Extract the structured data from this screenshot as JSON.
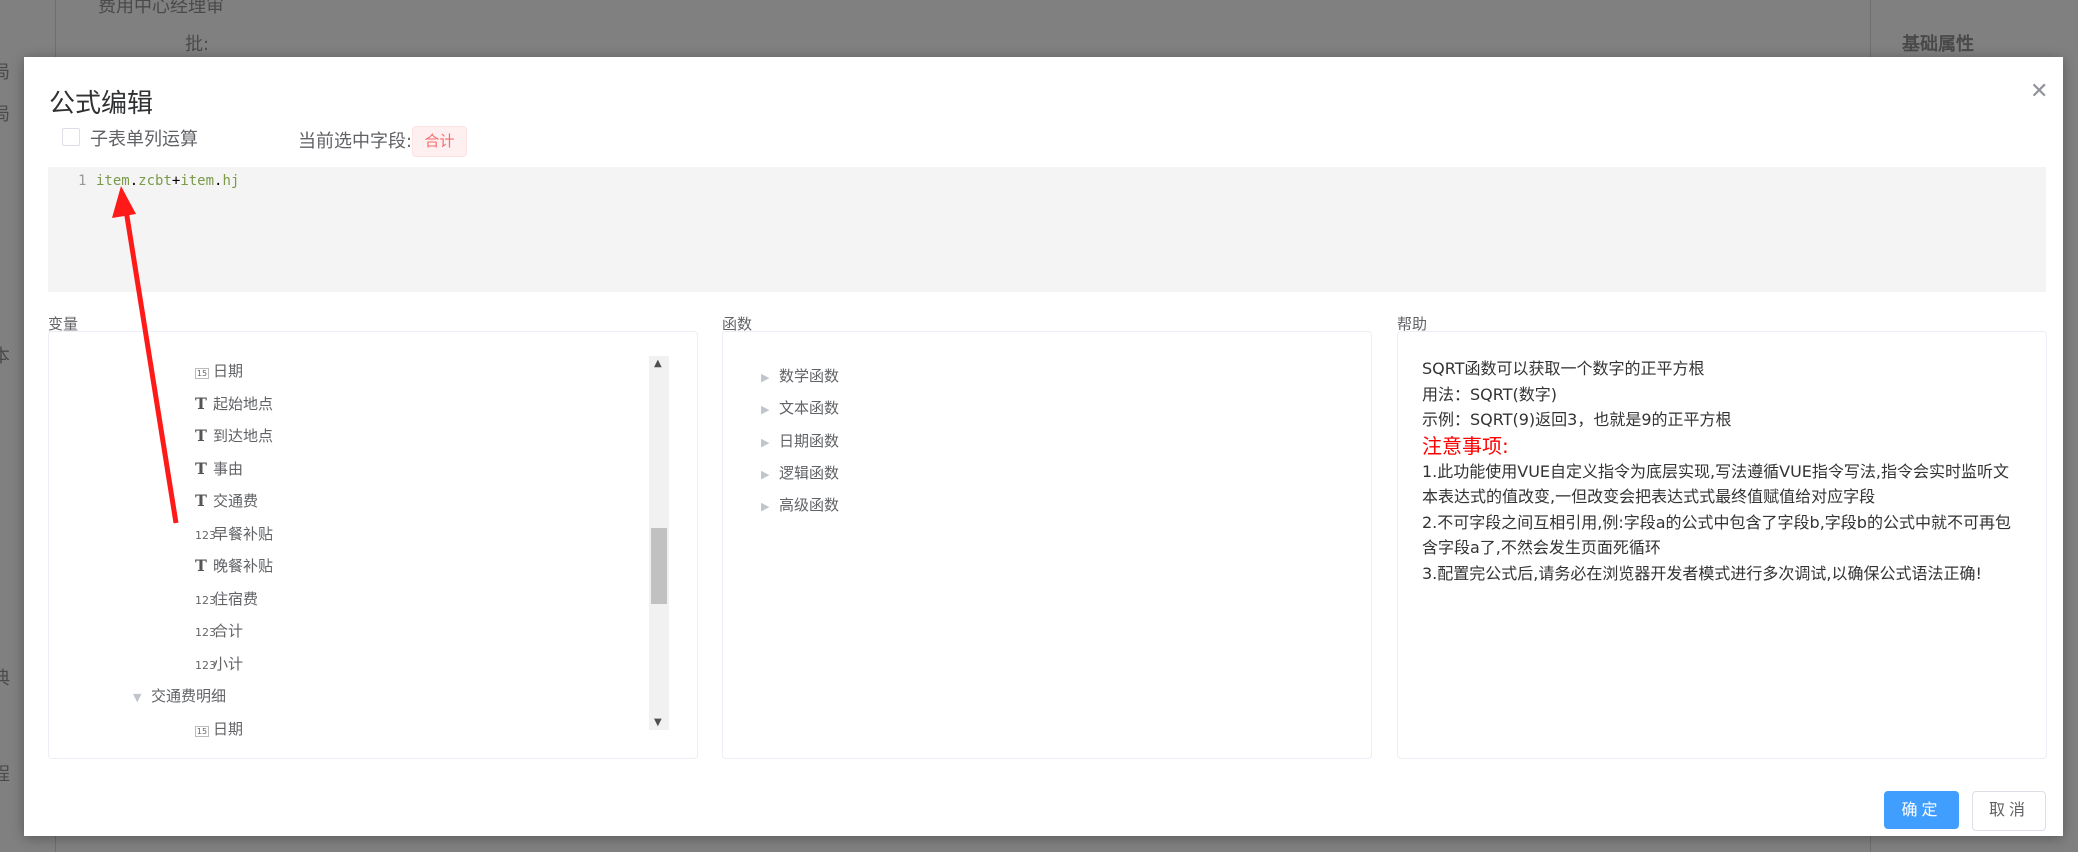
{
  "background": {
    "top_text": "费用中心经理审",
    "approve_label": "批:",
    "right_panel_title": "基础属性",
    "left_fragments": [
      "局",
      "局",
      "本",
      "典",
      "程"
    ]
  },
  "dialog": {
    "title": "公式编辑",
    "close_icon": "close-icon",
    "subform_checkbox_label": "子表单列运算",
    "subform_checked": false,
    "current_field_label": "当前选中字段:",
    "current_field_tag": "合计",
    "editor": {
      "line_number": "1",
      "tokens": [
        "item",
        ".",
        "zcbt",
        "+",
        "item",
        ".",
        "hj"
      ]
    },
    "variables": {
      "label": "变量",
      "items": [
        {
          "icon": "calendar-icon",
          "glyph": "15",
          "label": "日期"
        },
        {
          "icon": "text-icon",
          "glyph": "T",
          "label": "起始地点"
        },
        {
          "icon": "text-icon",
          "glyph": "T",
          "label": "到达地点"
        },
        {
          "icon": "text-icon",
          "glyph": "T",
          "label": "事由"
        },
        {
          "icon": "text-icon",
          "glyph": "T",
          "label": "交通费"
        },
        {
          "icon": "number-icon",
          "glyph": "123",
          "label": "早餐补贴"
        },
        {
          "icon": "text-icon",
          "glyph": "T",
          "label": "晚餐补贴"
        },
        {
          "icon": "number-icon",
          "glyph": "123",
          "label": "住宿费"
        },
        {
          "icon": "number-icon",
          "glyph": "123",
          "label": "合计"
        },
        {
          "icon": "number-icon",
          "glyph": "123",
          "label": "小计"
        }
      ],
      "group": {
        "label": "交通费明细",
        "expanded": true
      },
      "group_items": [
        {
          "icon": "calendar-icon",
          "glyph": "15",
          "label": "日期"
        }
      ]
    },
    "functions": {
      "label": "函数",
      "items": [
        "数学函数",
        "文本函数",
        "日期函数",
        "逻辑函数",
        "高级函数"
      ]
    },
    "help": {
      "label": "帮助",
      "lines": [
        "SQRT函数可以获取一个数字的正平方根",
        "用法：SQRT(数字)",
        "示例：SQRT(9)返回3，也就是9的正平方根"
      ],
      "warning_title": "注意事项:",
      "notes": [
        "1.此功能使用VUE自定义指令为底层实现,写法遵循VUE指令写法,指令会实时监听文本表达式的值改变,一但改变会把表达式式最终值赋值给对应字段",
        "2.不可字段之间互相引用,例:字段a的公式中包含了字段b,字段b的公式中就不可再包含字段a了,不然会发生页面死循环",
        "3.配置完公式后,请务必在浏览器开发者模式进行多次调试,以确保公式语法正确!"
      ]
    },
    "buttons": {
      "confirm": "确定",
      "cancel": "取消"
    },
    "colors": {
      "primary": "#409eff",
      "tag_text": "#f56c6c",
      "warning": "#ff0000",
      "annotation_arrow": "#ff1a1a"
    }
  }
}
